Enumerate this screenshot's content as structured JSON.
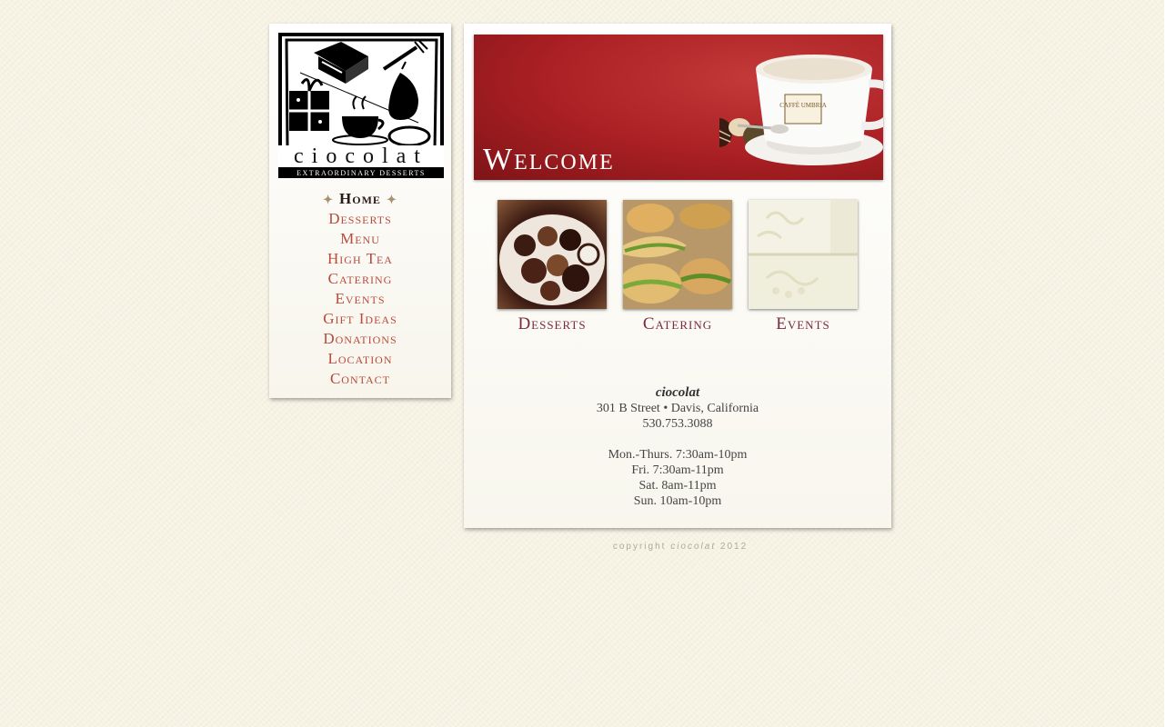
{
  "logo": {
    "wordmark": "ciocolat",
    "tagline": "EXTRAORDINARY DESSERTS"
  },
  "nav": {
    "items": [
      {
        "label": "Home",
        "active": true
      },
      {
        "label": "Desserts"
      },
      {
        "label": "Menu"
      },
      {
        "label": "High Tea"
      },
      {
        "label": "Catering"
      },
      {
        "label": "Events"
      },
      {
        "label": "Gift Ideas"
      },
      {
        "label": "Donations"
      },
      {
        "label": "Location"
      },
      {
        "label": "Contact"
      }
    ]
  },
  "banner": {
    "title": "Welcome",
    "cup_text": "CAFFÈ UMBRIA"
  },
  "tiles": [
    {
      "label": "Desserts"
    },
    {
      "label": "Catering"
    },
    {
      "label": "Events"
    }
  ],
  "info": {
    "brand": "ciocolat",
    "address": "301 B Street • Davis, California",
    "phone": "530.753.3088",
    "hours": [
      "Mon.-Thurs. 7:30am-10pm",
      "Fri. 7:30am-11pm",
      "Sat. 8am-11pm",
      "Sun. 10am-10pm"
    ]
  },
  "footer": {
    "copyright_prefix": "copyright",
    "copyright_brand": "ciocolat",
    "copyright_year": "2012"
  },
  "colors": {
    "background": "#f6f3e4",
    "nav_link": "#b84b3b",
    "nav_active": "#2a1a1a",
    "tile_label": "#7b2a3a",
    "banner_red": "#a91f23"
  }
}
